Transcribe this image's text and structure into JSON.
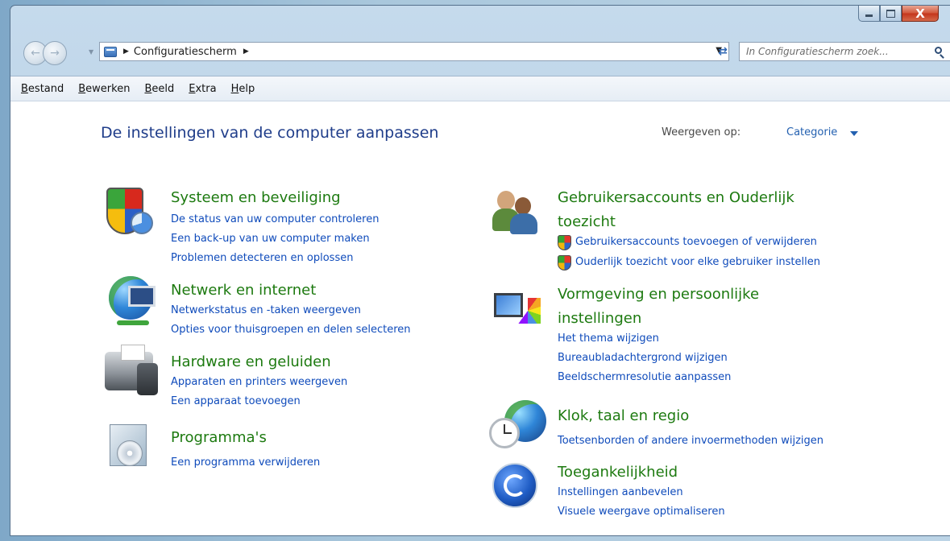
{
  "window": {
    "caption_buttons": {
      "minimize": "minimize",
      "maximize": "maximize",
      "close": "X"
    }
  },
  "navigation": {
    "address_path": "Configuratiescherm",
    "search_placeholder": "In Configuratiescherm zoek..."
  },
  "menubar": {
    "items": [
      "Bestand",
      "Bewerken",
      "Beeld",
      "Extra",
      "Help"
    ]
  },
  "main": {
    "title": "De instellingen van de computer aanpassen",
    "view_by_label": "Weergeven op:",
    "view_by_value": "Categorie"
  },
  "categories": {
    "left": [
      {
        "title": "Systeem en beveiliging",
        "icon": "security-shield-icon",
        "links": [
          "De status van uw computer controleren",
          "Een back-up van uw computer maken",
          "Problemen detecteren en oplossen"
        ]
      },
      {
        "title": "Netwerk en internet",
        "icon": "network-globe-icon",
        "links": [
          "Netwerkstatus en -taken weergeven",
          "Opties voor thuisgroepen en delen selecteren"
        ]
      },
      {
        "title": "Hardware en geluiden",
        "icon": "printer-speaker-icon",
        "links": [
          "Apparaten en printers weergeven",
          "Een apparaat toevoegen"
        ]
      },
      {
        "title": "Programma's",
        "icon": "programs-box-icon",
        "links": [
          "Een programma verwijderen"
        ]
      }
    ],
    "right": [
      {
        "title_line1": "Gebruikersaccounts en Ouderlijk",
        "title_line2": "toezicht",
        "icon": "users-icon",
        "links": [
          "Gebruikersaccounts toevoegen of verwijderen",
          "Ouderlijk toezicht voor elke gebruiker instellen"
        ]
      },
      {
        "title_line1": "Vormgeving en persoonlijke",
        "title_line2": "instellingen",
        "icon": "appearance-icon",
        "links": [
          "Het thema wijzigen",
          "Bureaubladachtergrond wijzigen",
          "Beeldschermresolutie aanpassen"
        ]
      },
      {
        "title": "Klok, taal en regio",
        "icon": "clock-globe-icon",
        "links": [
          "Toetsenborden of andere invoermethoden wijzigen"
        ]
      },
      {
        "title": "Toegankelijkheid",
        "icon": "accessibility-icon",
        "links": [
          "Instellingen aanbevelen",
          "Visuele weergave optimaliseren"
        ]
      }
    ]
  }
}
